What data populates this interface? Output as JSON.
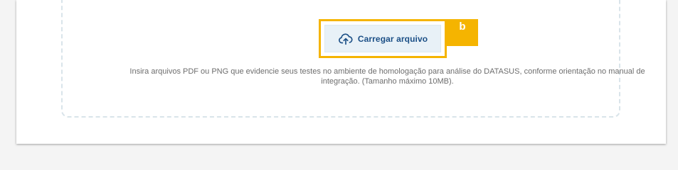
{
  "upload": {
    "button_label": "Carregar arquivo",
    "icon": "cloud-upload-icon"
  },
  "annotation": {
    "badge_label": "b",
    "highlight_color": "#f5b400"
  },
  "hint": {
    "text": "Insira arquivos PDF ou PNG que evidencie seus testes no ambiente de homologação para análise do DATASUS, conforme orientação no manual de integração. (Tamanho máximo 10MB)."
  },
  "colors": {
    "button_text": "#1b4f86",
    "button_bg": "#e8f1f7",
    "hint_text": "#6d6d6d"
  }
}
